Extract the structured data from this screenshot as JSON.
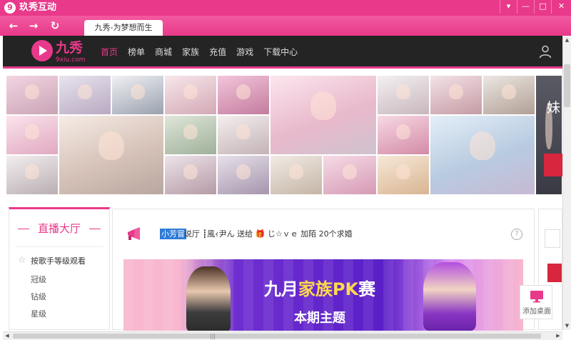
{
  "window": {
    "title": "玖秀互动",
    "logo_glyph": "9",
    "buttons": [
      {
        "name": "menu",
        "glyph": "▾"
      },
      {
        "name": "minimize",
        "glyph": "—"
      },
      {
        "name": "maximize",
        "glyph": "□"
      },
      {
        "name": "close",
        "glyph": "✕"
      }
    ]
  },
  "toolbar": {
    "back_glyph": "←",
    "forward_glyph": "→",
    "refresh_glyph": "↻",
    "tab_label": "九秀-为梦想而生"
  },
  "site": {
    "brand": "九秀",
    "url": "9xiu.com",
    "nav": [
      "首页",
      "榜单",
      "商城",
      "家族",
      "充值",
      "游戏",
      "下载中心"
    ],
    "active_nav_index": 0,
    "accent": "#e8398a"
  },
  "photo_wall": {
    "overlay_text": "妹"
  },
  "sidebar": {
    "title": "直播大厅",
    "sort_label": "按歌手等级观看",
    "levels": [
      "冠级",
      "钻级",
      "星级"
    ]
  },
  "notice": {
    "sender": "小芳冒",
    "text": "说厅 ┋風ｨ尹ん 送给 ",
    "gift_text": " じ☆ｖｅ 加陌 20个求婚",
    "help": "?"
  },
  "banner": {
    "title_prefix": "九月",
    "title_highlight": "家族PK",
    "title_suffix": "赛",
    "subtitle": "本期主题"
  },
  "add_desktop": {
    "label": "添加桌面"
  },
  "scroll": {
    "up": "▲",
    "down": "▼",
    "left": "◀",
    "right": "▶",
    "grip": "|||"
  }
}
